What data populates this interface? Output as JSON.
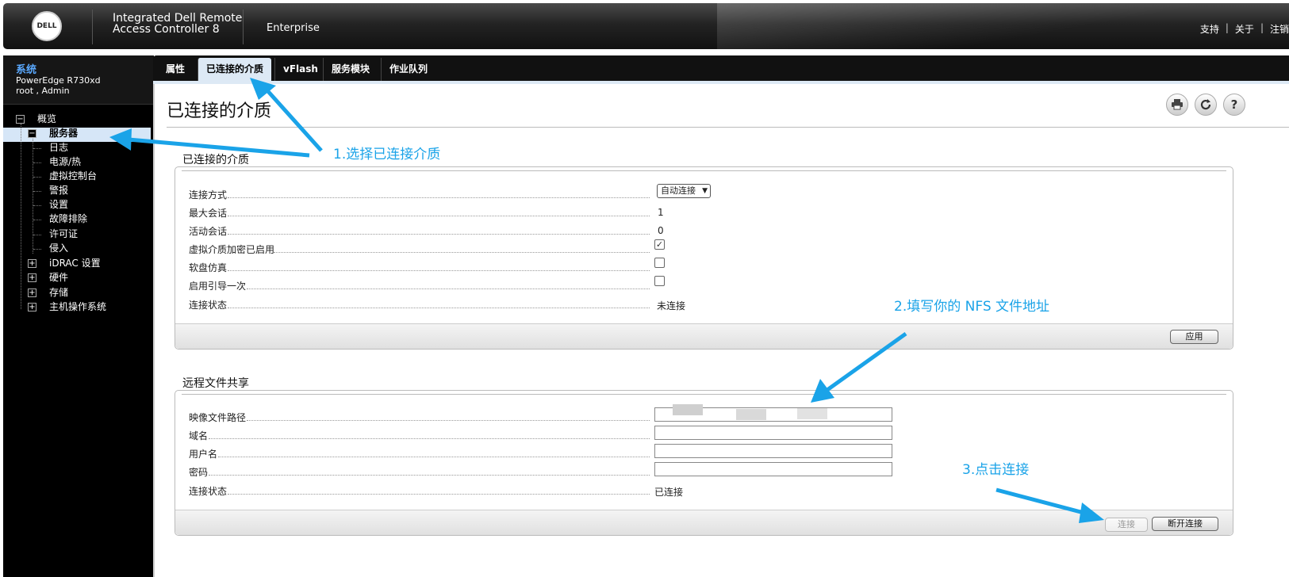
{
  "header": {
    "logo_text": "DELL",
    "product_line1": "Integrated Dell Remote",
    "product_line2": "Access Controller 8",
    "edition": "Enterprise",
    "links": [
      "支持",
      "关于",
      "注销"
    ],
    "separator": "|"
  },
  "sidebar": {
    "system_title": "系统",
    "model": "PowerEdge R730xd",
    "user": "root , Admin",
    "tree": {
      "overview": "概览",
      "server": "服务器",
      "children": [
        "日志",
        "电源/热",
        "虚拟控制台",
        "警报",
        "设置",
        "故障排除",
        "许可证",
        "侵入"
      ],
      "idrac_settings": "iDRAC 设置",
      "hardware": "硬件",
      "storage": "存储",
      "host_os": "主机操作系统"
    }
  },
  "tabs": [
    {
      "label": "属性",
      "active": false
    },
    {
      "label": "已连接的介质",
      "active": true
    },
    {
      "label": "vFlash",
      "active": false
    },
    {
      "label": "服务模块",
      "active": false
    },
    {
      "label": "作业队列",
      "active": false
    }
  ],
  "page": {
    "title": "已连接的介质",
    "icons": [
      "print-icon",
      "refresh-icon",
      "help-icon"
    ],
    "help_glyph": "?"
  },
  "attached_media": {
    "section_title": "已连接的介质",
    "rows": {
      "connect_mode_label": "连接方式",
      "connect_mode_value": "自动连接",
      "max_sessions_label": "最大会话",
      "max_sessions_value": "1",
      "active_sessions_label": "活动会话",
      "active_sessions_value": "0",
      "encryption_label": "虚拟介质加密已启用",
      "encryption_checked": true,
      "floppy_label": "软盘仿真",
      "floppy_checked": false,
      "boot_once_label": "启用引导一次",
      "boot_once_checked": false,
      "status_label": "连接状态",
      "status_value": "未连接"
    },
    "apply_button": "应用"
  },
  "remote_share": {
    "section_title": "远程文件共享",
    "image_path_label": "映像文件路径",
    "image_path_value": "",
    "domain_label": "域名",
    "domain_value": "",
    "username_label": "用户名",
    "username_value": "",
    "password_label": "密码",
    "password_value": "",
    "status_label": "连接状态",
    "status_value": "已连接",
    "connect_button": "连接",
    "disconnect_button": "断开连接"
  },
  "annotations": {
    "step1": "1.选择已连接介质",
    "step2": "2.填写你的 NFS 文件地址",
    "step3": "3.点击连接",
    "color": "#1aa3e8"
  }
}
